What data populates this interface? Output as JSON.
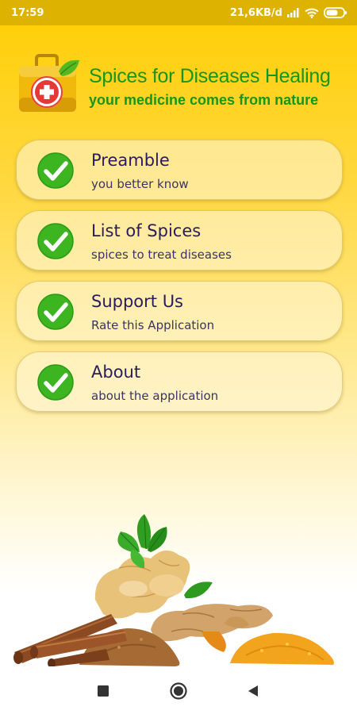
{
  "status_bar": {
    "time": "17:59",
    "network_speed": "21,6KB/d",
    "icons": [
      "signal-icon",
      "wifi-icon",
      "battery-icon"
    ]
  },
  "header": {
    "title": "Spices for Diseases Healing",
    "subtitle": "your medicine comes from nature",
    "logo_icon": "medical-bag-icon"
  },
  "menu": {
    "items": [
      {
        "title": "Preamble",
        "subtitle": "you better know",
        "icon": "check-icon"
      },
      {
        "title": "List of Spices",
        "subtitle": "spices to treat diseases",
        "icon": "check-icon"
      },
      {
        "title": "Support Us",
        "subtitle": "Rate this Application",
        "icon": "check-icon"
      },
      {
        "title": "About",
        "subtitle": "about the application",
        "icon": "check-icon"
      }
    ]
  },
  "nav_bar": {
    "buttons": [
      "recents-button",
      "home-button",
      "back-button"
    ]
  },
  "colors": {
    "brand_green": "#16961c",
    "status_bar": "#ddb200",
    "gradient_top": "#ffcf0a",
    "menu_text": "#2a1a5e"
  }
}
